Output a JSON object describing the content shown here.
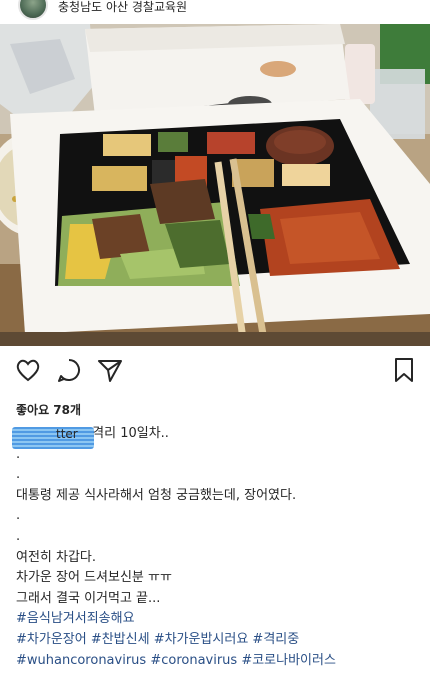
{
  "post": {
    "location": "충청남도 아산 경찰교육원",
    "likes_label": "좋아요 78개",
    "username_fragment": "tter",
    "caption_title": "격리 10일차..",
    "caption_lines": [
      ".",
      ".",
      "대통령 제공 식사라해서 엄청 궁금했는데, 장어였다.",
      ".",
      ".",
      "여전히 차갑다.",
      "차가운 장어 드셔보신분 ㅠㅠ",
      "그래서 결국 이거먹고 끝..."
    ],
    "hashtag_lines": [
      "#음식남겨서죄송해요",
      "#차가운장어 #찬밥신세 #차가운밥시러요 #격리중",
      "#wuhancoronavirus #coronavirus #코로나바이러스"
    ]
  },
  "icons": {
    "like": "heart-icon",
    "comment": "comment-icon",
    "share": "send-icon",
    "save": "bookmark-icon"
  },
  "colors": {
    "hashtag": "#2a4f86",
    "text": "#262626"
  }
}
